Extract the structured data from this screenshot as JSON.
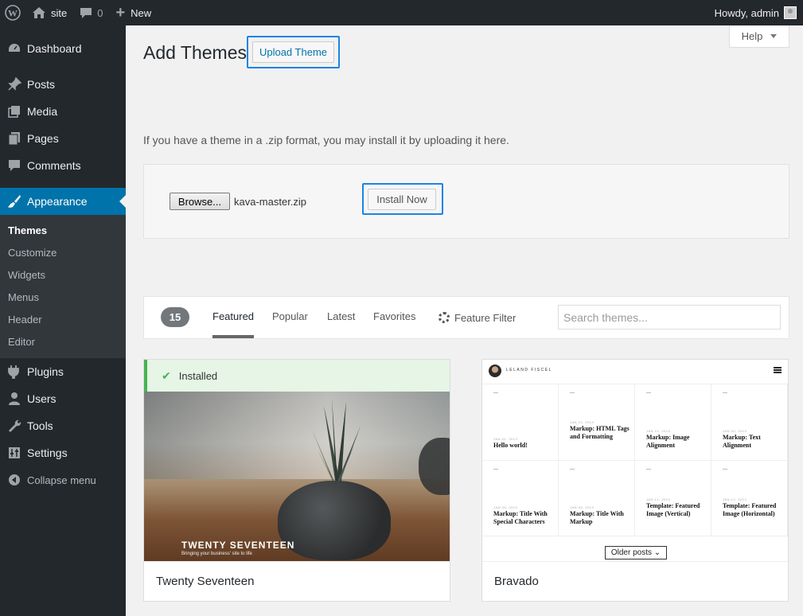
{
  "adminbar": {
    "site": "site",
    "comments_count": "0",
    "new_label": "New",
    "howdy": "Howdy, admin"
  },
  "sidebar": {
    "items": [
      {
        "label": "Dashboard",
        "icon": "dashboard-icon"
      },
      {
        "label": "Posts",
        "icon": "pin-icon"
      },
      {
        "label": "Media",
        "icon": "media-icon"
      },
      {
        "label": "Pages",
        "icon": "pages-icon"
      },
      {
        "label": "Comments",
        "icon": "comment-icon"
      },
      {
        "label": "Appearance",
        "icon": "brush-icon"
      },
      {
        "label": "Plugins",
        "icon": "plugin-icon"
      },
      {
        "label": "Users",
        "icon": "user-icon"
      },
      {
        "label": "Tools",
        "icon": "wrench-icon"
      },
      {
        "label": "Settings",
        "icon": "settings-icon"
      }
    ],
    "submenu": [
      "Themes",
      "Customize",
      "Widgets",
      "Menus",
      "Header",
      "Editor"
    ],
    "collapse": "Collapse menu"
  },
  "help": "Help",
  "page": {
    "title": "Add Themes",
    "upload_button": "Upload Theme",
    "intro": "If you have a theme in a .zip format, you may install it by uploading it here.",
    "browse_button": "Browse...",
    "file_name": "kava-master.zip",
    "install_button": "Install Now"
  },
  "filter": {
    "count": "15",
    "tabs": [
      "Featured",
      "Popular",
      "Latest",
      "Favorites"
    ],
    "feature_filter": "Feature Filter",
    "search_placeholder": "Search themes..."
  },
  "themes": [
    {
      "name": "Twenty Seventeen",
      "installed_label": "Installed",
      "screenshot_title": "TWENTY SEVENTEEN",
      "screenshot_tagline": "Bringing your business' site to life"
    },
    {
      "name": "Bravado",
      "author_label": "LELAND FISCEL",
      "posts": [
        {
          "date": "JAN 01, 2013",
          "title": "Hello world!"
        },
        {
          "date": "JAN 15, 2013",
          "title": "Markup: HTML Tags and Formatting"
        },
        {
          "date": "JAN 10, 2013",
          "title": "Markup: Image Alignment"
        },
        {
          "date": "JAN 09, 2013",
          "title": "Markup: Text Alignment"
        },
        {
          "date": "JAN 05, 2013",
          "title": "Markup: Title With Special Characters"
        },
        {
          "date": "JAN 05, 2013",
          "title": "Markup: Title With Markup"
        },
        {
          "date": "JAN 12, 2013",
          "title": "Template: Featured Image (Vertical)"
        },
        {
          "date": "JAN 12, 2013",
          "title": "Template: Featured Image (Horizontal)"
        }
      ],
      "older_posts": "Older posts ⌄"
    }
  ],
  "colors": {
    "adminbar": "#23282d",
    "active_menu": "#0073aa",
    "highlight": "#1a84e8",
    "installed_green": "#46b450"
  }
}
